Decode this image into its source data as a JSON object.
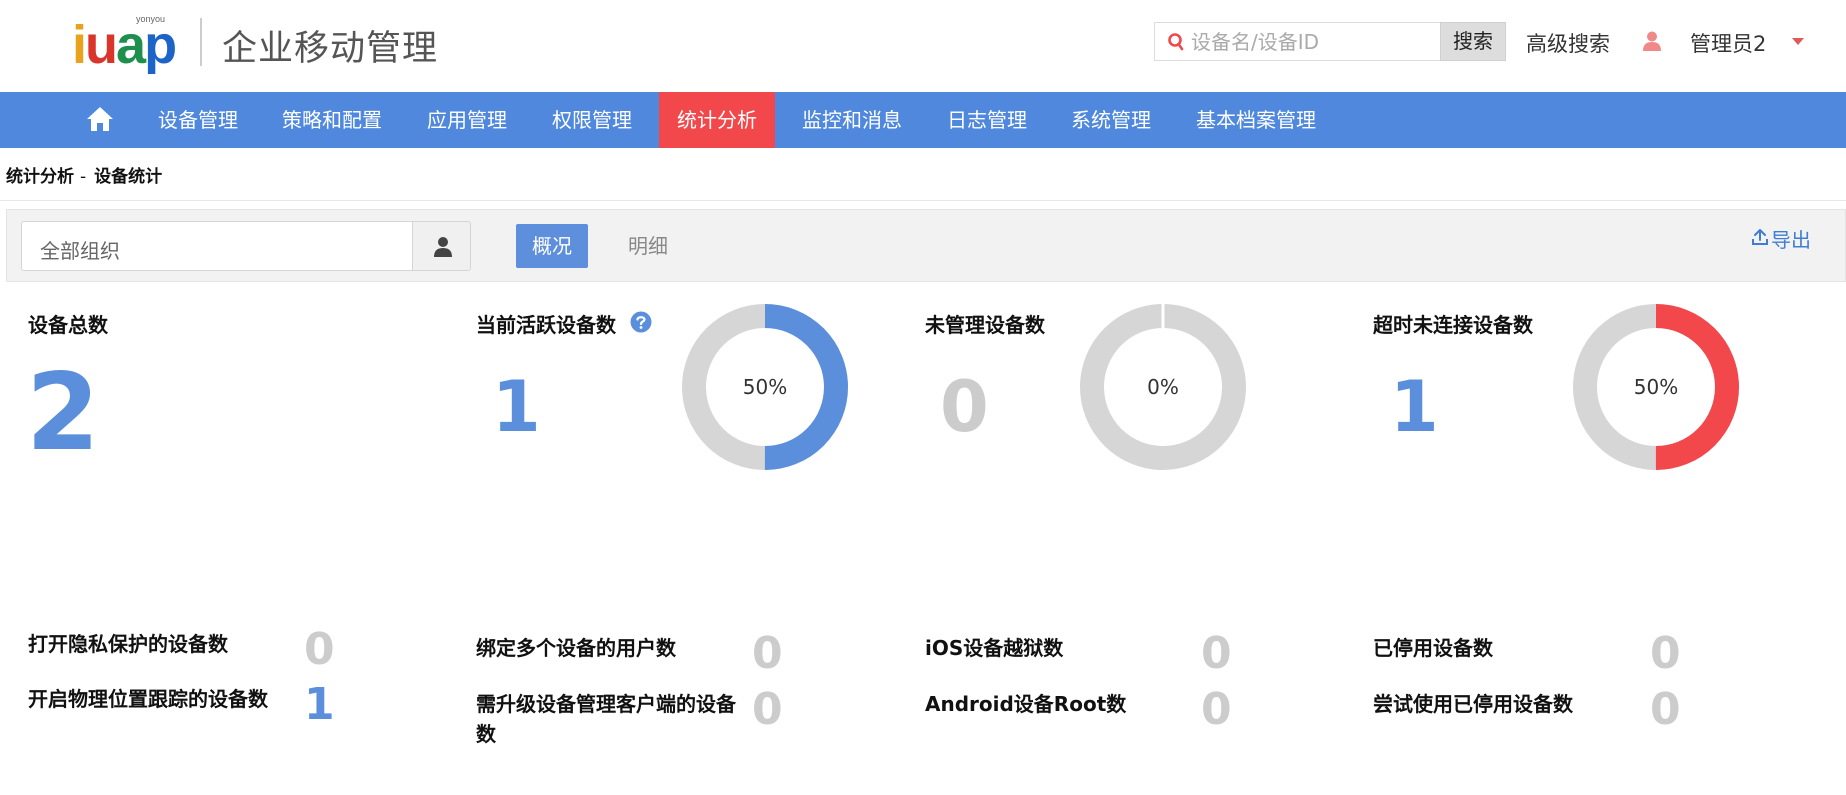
{
  "header": {
    "logo_small": "yonyou",
    "logo_word": [
      "i",
      "u",
      "a",
      "p"
    ],
    "app_title": "企业移动管理",
    "search_placeholder": "设备名/设备ID",
    "search_button": "搜索",
    "advanced_search": "高级搜索",
    "user_name": "管理员2"
  },
  "nav": {
    "items": [
      "设备管理",
      "策略和配置",
      "应用管理",
      "权限管理",
      "统计分析",
      "监控和消息",
      "日志管理",
      "系统管理",
      "基本档案管理"
    ],
    "active": "统计分析"
  },
  "breadcrumb": {
    "parent": "统计分析",
    "separator": "-",
    "current": "设备统计"
  },
  "toolbar": {
    "org_value": "全部组织",
    "tab_overview": "概况",
    "tab_detail": "明细",
    "export": "导出"
  },
  "stats": {
    "total": {
      "label": "设备总数",
      "value": "2"
    },
    "active": {
      "label": "当前活跃设备数",
      "value": "1",
      "percent_text": "50%",
      "percent": 50,
      "color": "#5b8fdb"
    },
    "unmanaged": {
      "label": "未管理设备数",
      "value": "0",
      "percent_text": "0%",
      "percent": 0,
      "color": "#d6d6d6"
    },
    "timeout": {
      "label": "超时未连接设备数",
      "value": "1",
      "percent_text": "50%",
      "percent": 50,
      "color": "#f2484b"
    }
  },
  "metrics": [
    {
      "label": "打开隐私保护的设备数",
      "value": "0"
    },
    {
      "label": "开启物理位置跟踪的设备数",
      "value": "1"
    },
    {
      "label": "绑定多个设备的用户数",
      "value": "0"
    },
    {
      "label": "需升级设备管理客户端的设备数",
      "value": "0"
    },
    {
      "label": "iOS设备越狱数",
      "value": "0"
    },
    {
      "label": "Android设备Root数",
      "value": "0"
    },
    {
      "label": "已停用设备数",
      "value": "0"
    },
    {
      "label": "尝试使用已停用设备数",
      "value": "0"
    }
  ],
  "colors": {
    "nav_bg": "#4f88dd",
    "nav_active": "#f2484b",
    "accent_blue": "#5b8fdb",
    "ring_gray": "#d6d6d6",
    "alert_red": "#f2484b"
  },
  "icons": [
    "search-icon",
    "user-icon",
    "caret-down-icon",
    "home-icon",
    "person-icon",
    "help-icon",
    "upload-icon"
  ]
}
